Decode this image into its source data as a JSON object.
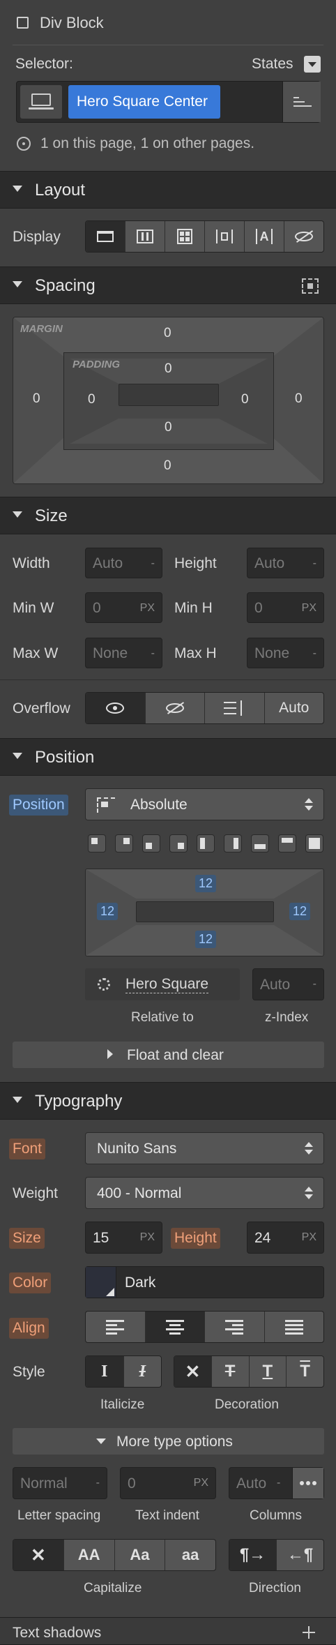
{
  "header": {
    "element_type": "Div Block",
    "selector_label": "Selector:",
    "states_label": "States",
    "class_name": "Hero Square Center",
    "usage_text": "1 on this page, 1 on other pages."
  },
  "layout": {
    "title": "Layout",
    "display_label": "Display"
  },
  "spacing": {
    "title": "Spacing",
    "margin_label": "MARGIN",
    "padding_label": "PADDING",
    "margin": {
      "top": "0",
      "right": "0",
      "bottom": "0",
      "left": "0"
    },
    "padding": {
      "top": "0",
      "right": "0",
      "bottom": "0",
      "left": "0"
    }
  },
  "size": {
    "title": "Size",
    "width_label": "Width",
    "width_value": "Auto",
    "width_unit": "-",
    "height_label": "Height",
    "height_value": "Auto",
    "height_unit": "-",
    "minw_label": "Min W",
    "minw_value": "0",
    "minw_unit": "PX",
    "minh_label": "Min H",
    "minh_value": "0",
    "minh_unit": "PX",
    "maxw_label": "Max W",
    "maxw_value": "None",
    "maxw_unit": "-",
    "maxh_label": "Max H",
    "maxh_value": "None",
    "maxh_unit": "-",
    "overflow_label": "Overflow",
    "overflow_auto": "Auto"
  },
  "position": {
    "title": "Position",
    "position_label": "Position",
    "position_value": "Absolute",
    "offsets": {
      "top": "12",
      "right": "12",
      "bottom": "12",
      "left": "12"
    },
    "relative_to_value": "Hero Square",
    "relative_to_label": "Relative to",
    "zindex_value": "Auto",
    "zindex_unit": "-",
    "zindex_label": "z-Index",
    "float_clear": "Float and clear"
  },
  "typography": {
    "title": "Typography",
    "font_label": "Font",
    "font_value": "Nunito Sans",
    "weight_label": "Weight",
    "weight_value": "400 - Normal",
    "size_label": "Size",
    "size_value": "15",
    "size_unit": "PX",
    "height_label": "Height",
    "height_value": "24",
    "height_unit": "PX",
    "color_label": "Color",
    "color_value": "Dark",
    "color_swatch": "#2c2f3a",
    "align_label": "Align",
    "style_label": "Style",
    "italicize_label": "Italicize",
    "decoration_label": "Decoration",
    "more_options": "More type options",
    "letter_spacing_value": "Normal",
    "letter_spacing_unit": "-",
    "letter_spacing_label": "Letter spacing",
    "text_indent_value": "0",
    "text_indent_unit": "PX",
    "text_indent_label": "Text indent",
    "columns_value": "Auto",
    "columns_unit": "-",
    "columns_label": "Columns",
    "capitalize_label": "Capitalize",
    "direction_label": "Direction",
    "caps_options": [
      "AA",
      "Aa",
      "aa"
    ]
  },
  "text_shadows": {
    "title": "Text shadows"
  },
  "colors": {
    "panel": "#404040",
    "header": "#2b2b2b",
    "accent_blue": "#3879d9",
    "highlight_blue": "#3c5878",
    "highlight_orange": "#6b4a39"
  }
}
